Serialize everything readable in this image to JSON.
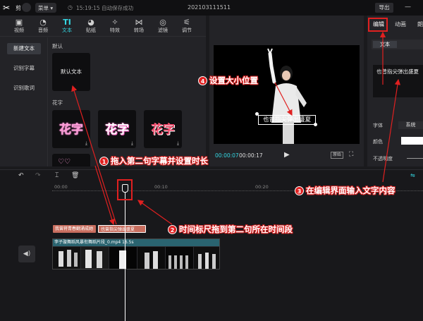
{
  "titlebar": {
    "app_name": "剪",
    "menu_label": "菜单 ▾",
    "save_time": "15:19:15",
    "save_status": "自动保存成功",
    "project_title": "202103111511",
    "export_label": "导出",
    "minimize_label": "—"
  },
  "media_tabs": [
    {
      "label": "视频",
      "icon": "video-icon"
    },
    {
      "label": "音频",
      "icon": "audio-icon"
    },
    {
      "label": "文本",
      "icon": "text-icon",
      "active": true
    },
    {
      "label": "贴纸",
      "icon": "sticker-icon"
    },
    {
      "label": "特效",
      "icon": "effect-icon"
    },
    {
      "label": "转场",
      "icon": "transition-icon"
    },
    {
      "label": "滤镜",
      "icon": "filter-icon"
    },
    {
      "label": "调节",
      "icon": "adjust-icon"
    }
  ],
  "text_categories": [
    "新建文本",
    "识别字幕",
    "识别歌词"
  ],
  "sections": {
    "default_label": "默认",
    "default_card": "默认文本",
    "fancy_label": "花字",
    "fancy_cards": [
      "花字",
      "花字",
      "花字"
    ]
  },
  "player": {
    "current_time": "00:00:07",
    "total_time": "00:00:17",
    "ratio_label": "原始",
    "caption": "也曾指尖弹出盛夏"
  },
  "properties": {
    "tab_edit": "编辑",
    "tab_animation": "动画",
    "tab_reading": "朗",
    "subtab_text": "文本",
    "subtab_other": "",
    "text_content": "也曾指尖弹出盛夏",
    "font_label": "字体",
    "font_value": "系统",
    "color_label": "颜色",
    "opacity_label": "不透明度",
    "text_color": "#ffffff"
  },
  "timeline": {
    "ticks": [
      "00:00",
      "00:10",
      "00:20"
    ],
    "subtitle_clips": [
      "我曾将青春翻涌成她",
      "也曾指尖弹出盛夏"
    ],
    "video_clip_label": "李子璇舞蹈风暴衔舞蹈片段_0.mp4   16.5s"
  },
  "annotations": [
    {
      "num": "1",
      "text": "拖入第二句字幕并设置时长"
    },
    {
      "num": "2",
      "text": "时间标尺拖到第二句所在时间段"
    },
    {
      "num": "3",
      "text": "在编辑界面输入文字内容"
    },
    {
      "num": "4",
      "text": "设置大小位置"
    }
  ],
  "colors": {
    "accent": "#34d6e2",
    "annotation_red": "#e02020",
    "subtitle_clip": "#c86e5f",
    "video_clip_head": "#2a6470"
  }
}
